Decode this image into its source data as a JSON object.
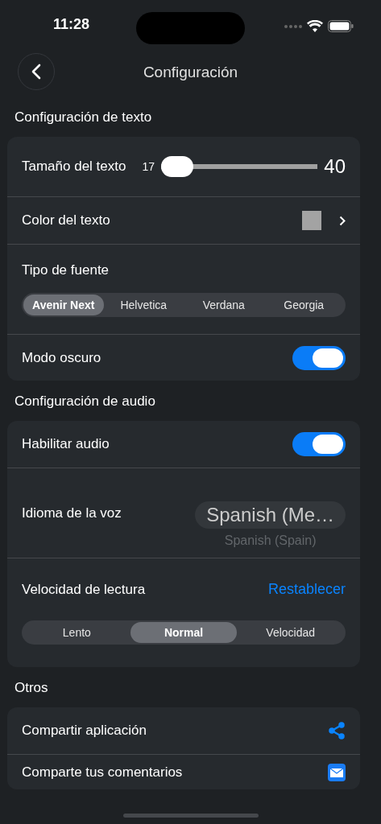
{
  "status_bar": {
    "time": "11:28"
  },
  "nav": {
    "title": "Configuración"
  },
  "sections": [
    {
      "heading": "Configuración de texto",
      "rows": [
        {
          "kind": "slider",
          "label": "Tamaño del texto",
          "min_label": "17",
          "max_label": "40",
          "level": 0
        },
        {
          "kind": "color",
          "label": "Color del texto",
          "color": "#a3a3a3"
        },
        {
          "kind": "segmented",
          "label": "Tipo de fuente",
          "options": [
            {
              "label": "Avenir Next",
              "selected": true
            },
            {
              "label": "Helvetica",
              "selected": false
            },
            {
              "label": "Verdana",
              "selected": false
            },
            {
              "label": "Georgia",
              "selected": false
            }
          ]
        },
        {
          "kind": "toggle",
          "label": "Modo oscuro",
          "on": true
        }
      ]
    },
    {
      "heading": "Configuración de audio",
      "rows": [
        {
          "kind": "toggle",
          "label": "Habilitar audio",
          "on": true
        },
        {
          "kind": "picker",
          "label": "Idioma de la voz",
          "value": "Spanish (Me…",
          "next_option": "Spanish (Spain)"
        },
        {
          "kind": "speed",
          "label": "Velocidad de lectura",
          "link": "Restablecer",
          "options": [
            {
              "label": "Lento",
              "selected": false
            },
            {
              "label": "Normal",
              "selected": true
            },
            {
              "label": "Velocidad",
              "selected": false
            }
          ]
        }
      ]
    },
    {
      "heading": "Otros",
      "rows": [
        {
          "kind": "share",
          "label": "Compartir aplicación"
        },
        {
          "kind": "mail",
          "label": "Comparte tus comentarios"
        }
      ]
    }
  ]
}
